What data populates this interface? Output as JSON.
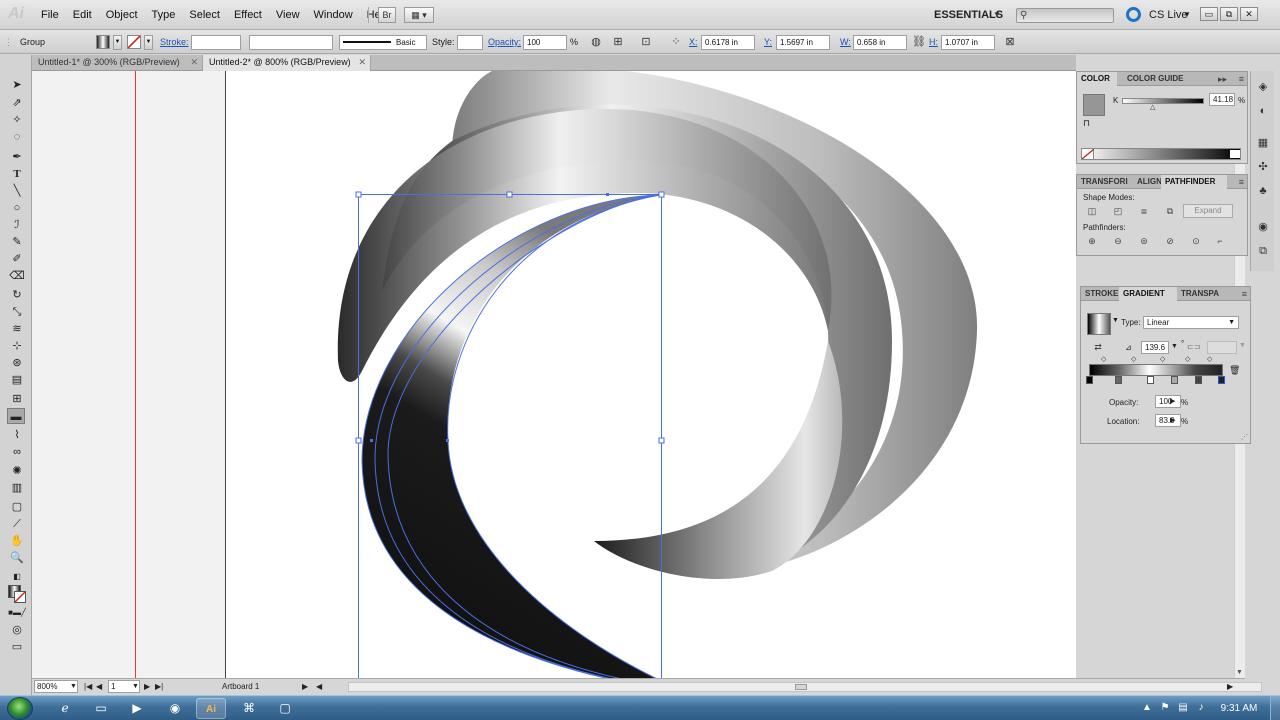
{
  "app": {
    "logo": "Ai"
  },
  "menu": [
    "File",
    "Edit",
    "Object",
    "Type",
    "Select",
    "Effect",
    "View",
    "Window",
    "Help"
  ],
  "menubar": {
    "bridge_label": "Br",
    "arrange_label": "▦ ▾",
    "workspace": "ESSENTIALS",
    "cslive": "CS Live",
    "window_min": "▭",
    "window_restore": "⧉",
    "window_close": "✕"
  },
  "control": {
    "selection": "Group",
    "stroke_label": "Stroke:",
    "brush_label": "Basic",
    "style_label": "Style:",
    "opacity_label": "Opacity:",
    "opacity_value": "100",
    "opacity_unit": "%",
    "x_label": "X:",
    "x_value": "0.6178 in",
    "y_label": "Y:",
    "y_value": "1.5697 in",
    "w_label": "W:",
    "w_value": "0.658 in",
    "h_label": "H:",
    "h_value": "1.0707 in"
  },
  "tabs": [
    {
      "label": "Untitled-1* @ 300% (RGB/Preview)",
      "close": "✕"
    },
    {
      "label": "Untitled-2* @ 800% (RGB/Preview)",
      "close": "✕"
    }
  ],
  "color_panel": {
    "tab_color": "COLOR",
    "tab_guide": "COLOR GUIDE",
    "channel": "K",
    "k_value": "41.18",
    "unit": "%",
    "current_fill": "#969696"
  },
  "pathfinder_panel": {
    "tab_transform": "TRANSFORI",
    "tab_align": "ALIGN",
    "tab_pathfinder": "PATHFINDER",
    "shape_modes": "Shape Modes:",
    "expand": "Expand",
    "pathfinders": "Pathfinders:"
  },
  "gradient_panel": {
    "tab_stroke": "STROKE",
    "tab_gradient": "GRADIENT",
    "tab_transparency": "TRANSPA",
    "type_label": "Type:",
    "type_value": "Linear",
    "angle_value": "139.6",
    "angle_unit": "°",
    "opacity_label": "Opacity:",
    "opacity_value": "100",
    "location_label": "Location:",
    "location_value": "83.0",
    "unit": "%"
  },
  "status": {
    "zoom": "800%",
    "artboard_num": "1",
    "artboard_name": "Artboard 1"
  },
  "taskbar": {
    "time": "9:31 AM"
  },
  "colors": {
    "selection": "#4a6fe0",
    "guide": "#e53838"
  }
}
